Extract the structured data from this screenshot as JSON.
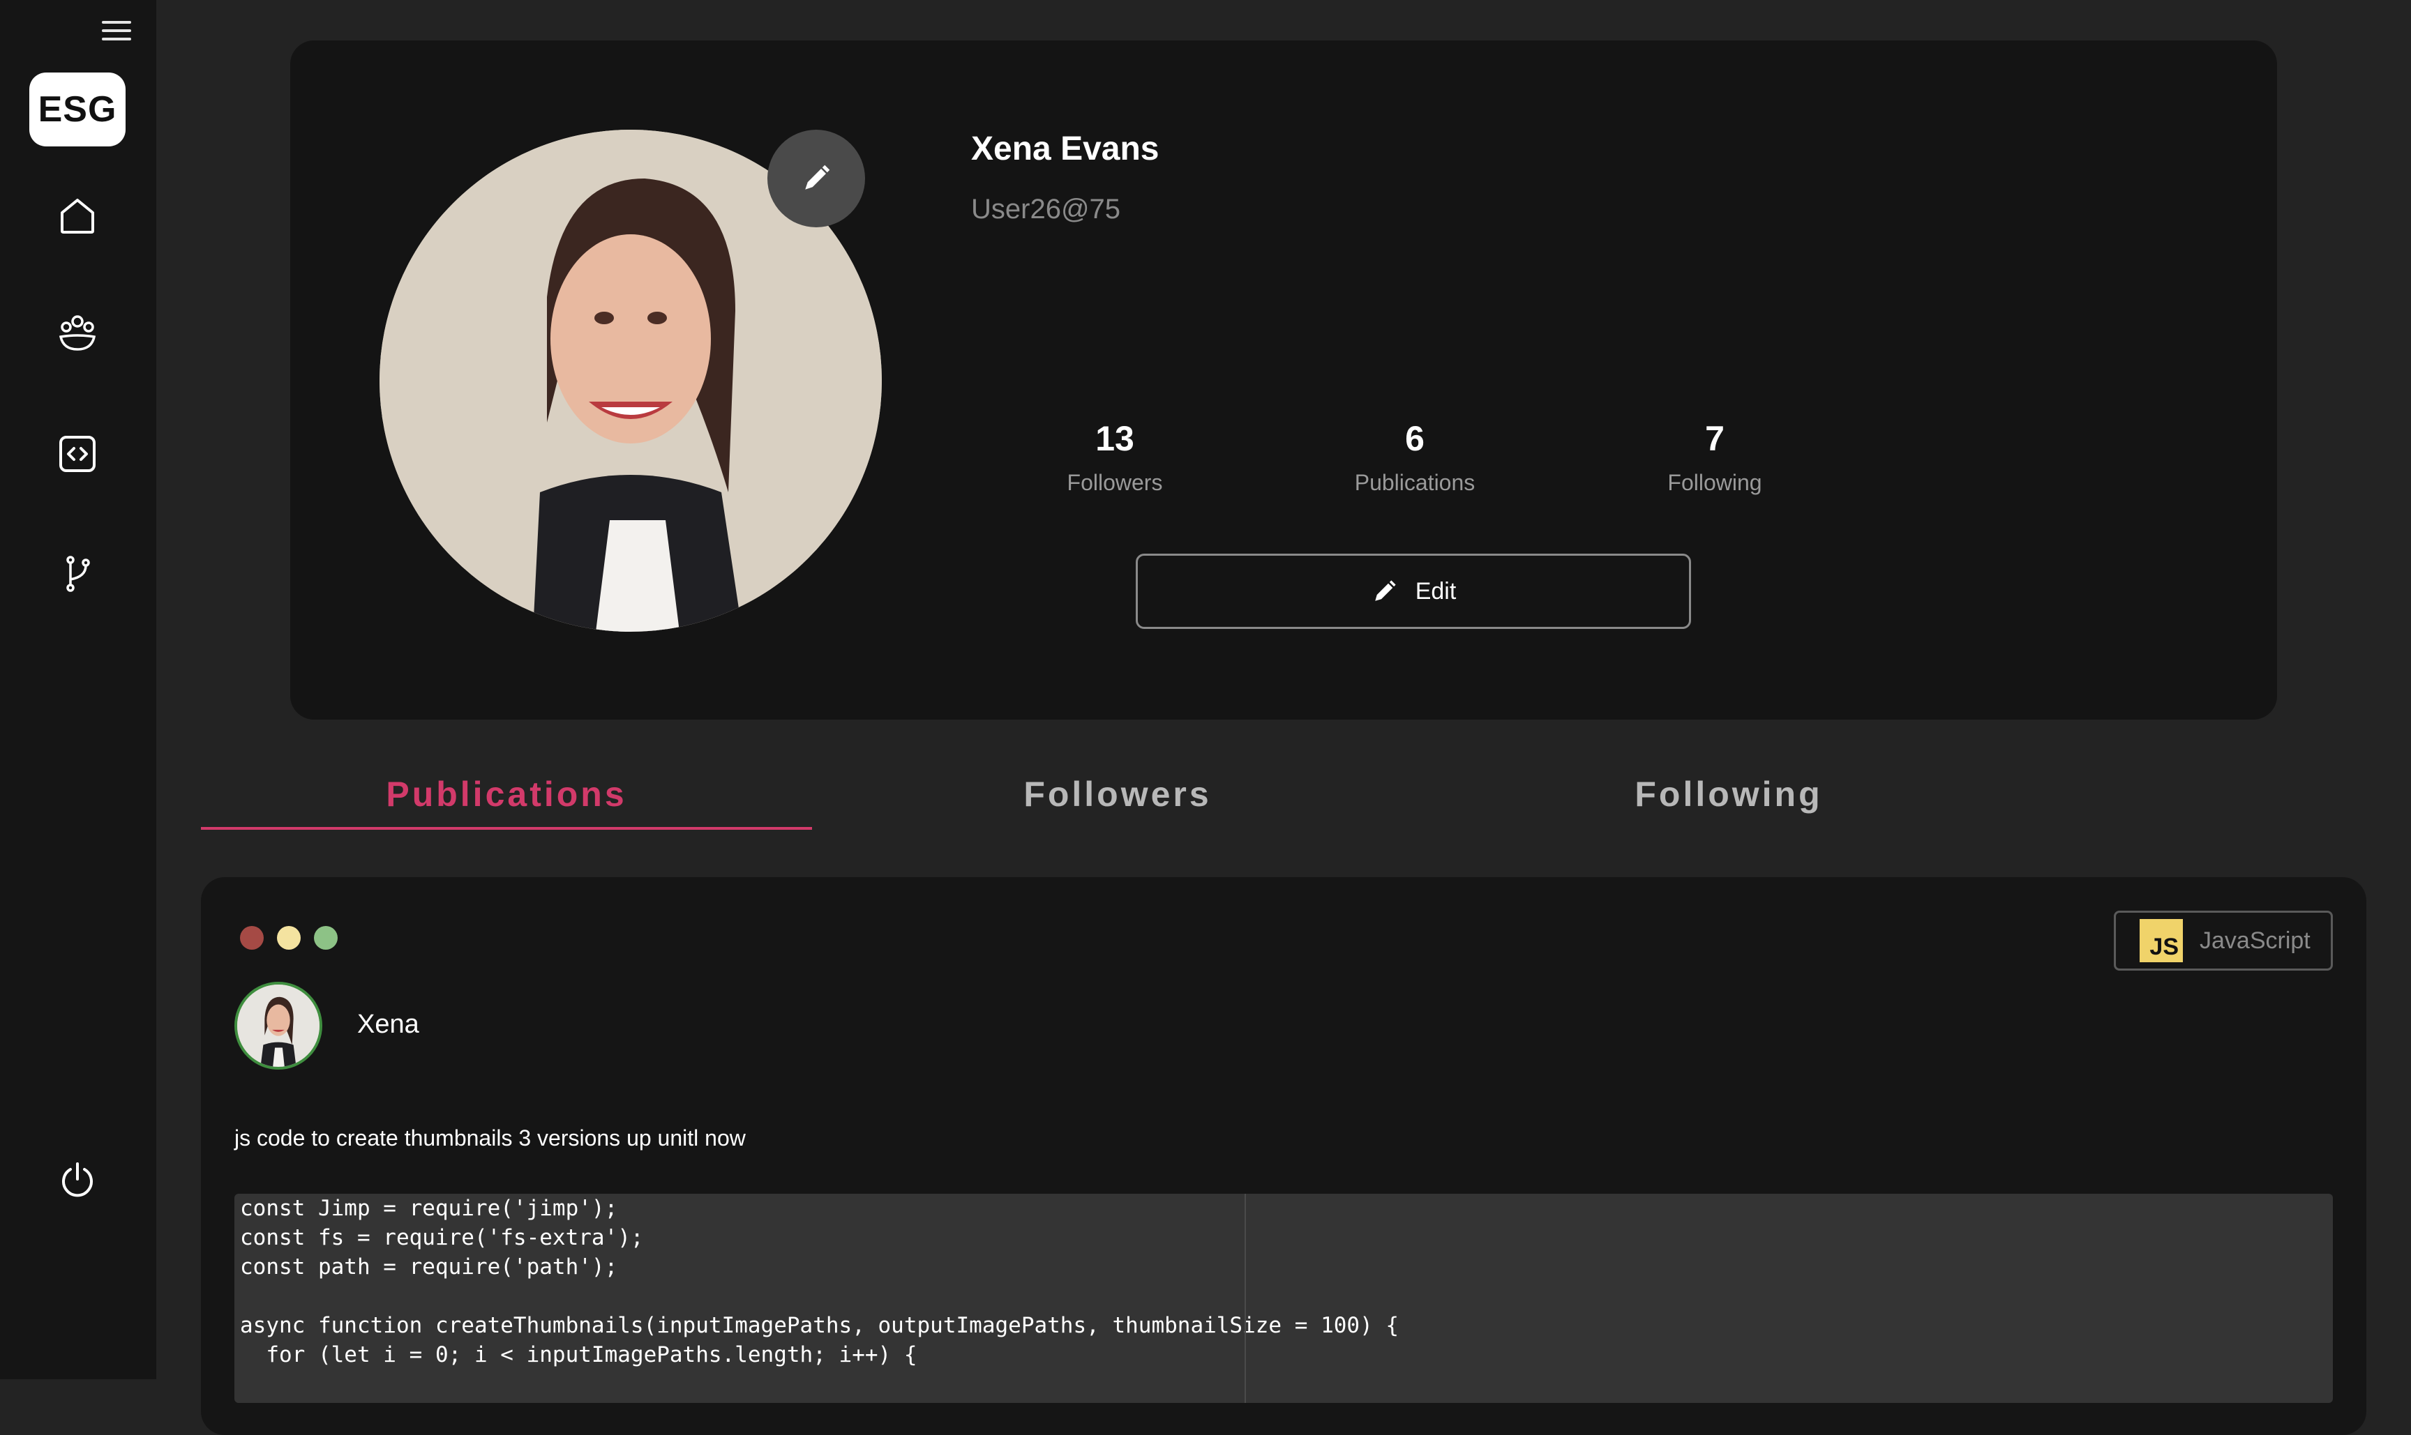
{
  "sidebar": {
    "logo": "ESG",
    "items": [
      {
        "icon": "home-icon"
      },
      {
        "icon": "community-icon"
      },
      {
        "icon": "code-icon"
      },
      {
        "icon": "git-branch-icon"
      }
    ],
    "logout_icon": "power-icon"
  },
  "profile": {
    "name": "Xena Evans",
    "handle": "User26@75",
    "stats": [
      {
        "value": "13",
        "label": "Followers"
      },
      {
        "value": "6",
        "label": "Publications"
      },
      {
        "value": "7",
        "label": "Following"
      }
    ],
    "edit_label": "Edit"
  },
  "tabs": [
    {
      "label": "Publications",
      "active": true
    },
    {
      "label": "Followers",
      "active": false
    },
    {
      "label": "Following",
      "active": false
    }
  ],
  "publication": {
    "author": "Xena",
    "language": "JavaScript",
    "language_badge": "JS",
    "description": "js code to create thumbnails 3 versions up unitl now",
    "code_lines": [
      "const Jimp = require('jimp');",
      "const fs = require('fs-extra');",
      "const path = require('path');",
      "",
      "async function createThumbnails(inputImagePaths, outputImagePaths, thumbnailSize = 100) {",
      "  for (let i = 0; i < inputImagePaths.length; i++) {"
    ]
  },
  "colors": {
    "accent": "#d23a6a",
    "window_red": "#a54a45",
    "window_yellow": "#f4e3a0",
    "window_green": "#8dc286"
  }
}
